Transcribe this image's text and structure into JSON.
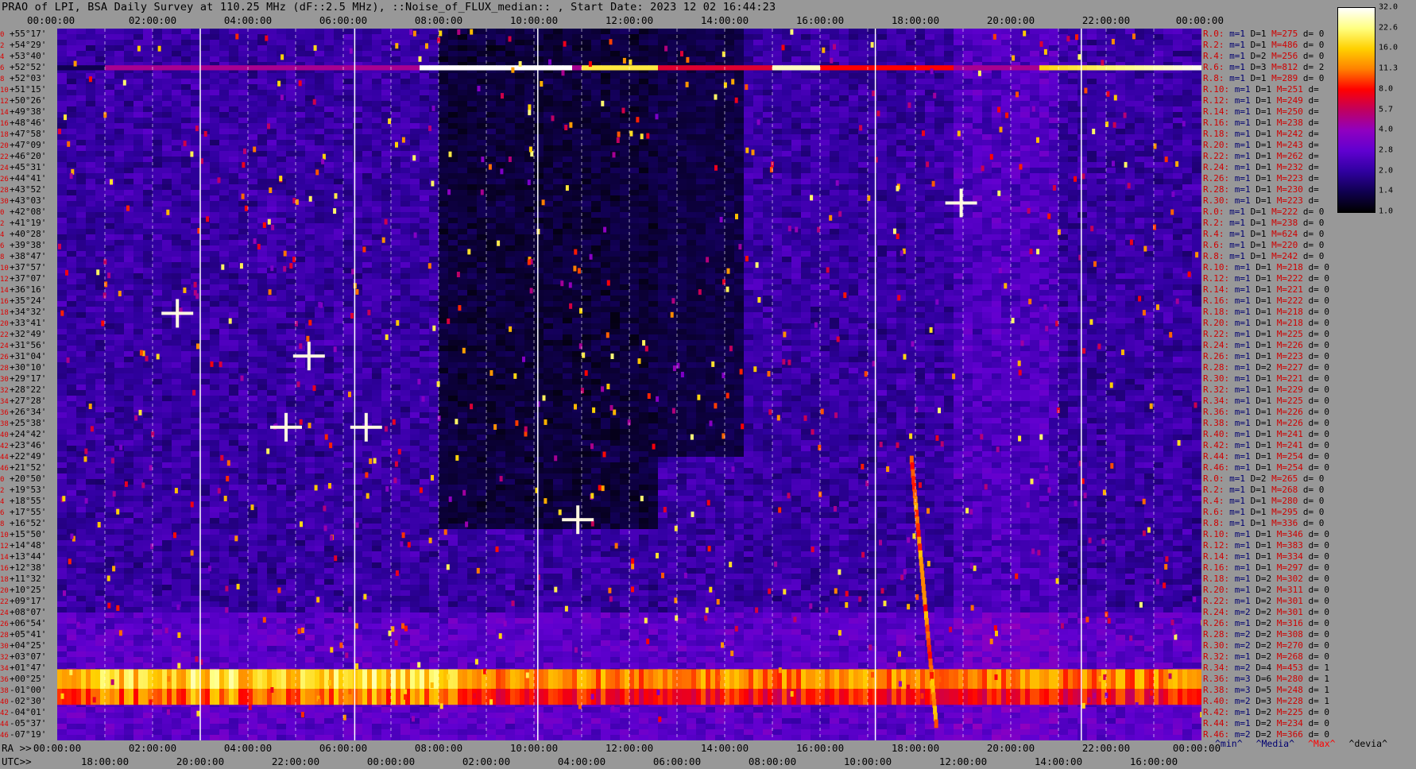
{
  "title": "PRAO of LPI, BSA Daily Survey at 110.25 MHz (dF::2.5 MHz), ::Noise_of_FLUX_median:: , Start Date: 2023 12 02 16:44:23",
  "top_axis_labels": [
    "00:00:00",
    "02:00:00",
    "04:00:00",
    "06:00:00",
    "08:00:00",
    "10:00:00",
    "12:00:00",
    "14:00:00",
    "16:00:00",
    "18:00:00",
    "20:00:00",
    "22:00:00",
    "00:00:00"
  ],
  "bottom_axis": {
    "ra_prefix": "RA >>",
    "ra_labels": [
      "00:00:00",
      "02:00:00",
      "04:00:00",
      "06:00:00",
      "08:00:00",
      "10:00:00",
      "12:00:00",
      "14:00:00",
      "16:00:00",
      "18:00:00",
      "20:00:00",
      "22:00:00",
      "00:00:00"
    ],
    "utc_prefix": "UTC>>",
    "utc_labels": [
      "18:00:00",
      "20:00:00",
      "22:00:00",
      "00:00:00",
      "02:00:00",
      "04:00:00",
      "06:00:00",
      "08:00:00",
      "10:00:00",
      "12:00:00",
      "14:00:00",
      "16:00:00"
    ]
  },
  "colorbar": {
    "ticks": [
      "32.0",
      "22.6",
      "16.0",
      "11.3",
      "8.0",
      "5.7",
      "4.0",
      "2.8",
      "2.0",
      "1.4",
      "1.0"
    ],
    "colors": [
      "#ffffff",
      "#ffff80",
      "#ffd000",
      "#ff8000",
      "#ff0000",
      "#c00060",
      "#9000c0",
      "#6000d0",
      "#3000a0",
      "#100050",
      "#000000"
    ]
  },
  "legend_keys": {
    "min": "^min^",
    "median": "^Media^",
    "max": "^Max^",
    "devia": "^devia^",
    "min_color": "#000070",
    "median_color": "#000070",
    "max_color": "#ff0000",
    "devia_color": "#000000"
  },
  "rows": [
    {
      "idx": "0",
      "dec": "+55°17'",
      "r": "R.0:",
      "m": "m=1",
      "D": "D=1",
      "M": "M=275",
      "d": "d= 0"
    },
    {
      "idx": "2",
      "dec": "+54°29'",
      "r": "R.2:",
      "m": "m=1",
      "D": "D=1",
      "M": "M=486",
      "d": "d= 0"
    },
    {
      "idx": "4",
      "dec": "+53°40'",
      "r": "R.4:",
      "m": "m=1",
      "D": "D=2",
      "M": "M=256",
      "d": "d= 0"
    },
    {
      "idx": "6",
      "dec": "+52°52'",
      "r": "R.6:",
      "m": "m=1",
      "D": "D=3",
      "M": "M=812",
      "d": "d= 2"
    },
    {
      "idx": "8",
      "dec": "+52°03'",
      "r": "R.8:",
      "m": "m=1",
      "D": "D=1",
      "M": "M=289",
      "d": "d= 0"
    },
    {
      "idx": "10",
      "dec": "+51°15'",
      "r": "R.10:",
      "m": "m=1",
      "D": "D=1",
      "M": "M=251",
      "d": "d="
    },
    {
      "idx": "12",
      "dec": "+50°26'",
      "r": "R.12:",
      "m": "m=1",
      "D": "D=1",
      "M": "M=249",
      "d": "d="
    },
    {
      "idx": "14",
      "dec": "+49°38'",
      "r": "R.14:",
      "m": "m=1",
      "D": "D=1",
      "M": "M=250",
      "d": "d="
    },
    {
      "idx": "16",
      "dec": "+48°46'",
      "r": "R.16:",
      "m": "m=1",
      "D": "D=1",
      "M": "M=238",
      "d": "d="
    },
    {
      "idx": "18",
      "dec": "+47°58'",
      "r": "R.18:",
      "m": "m=1",
      "D": "D=1",
      "M": "M=242",
      "d": "d="
    },
    {
      "idx": "20",
      "dec": "+47°09'",
      "r": "R.20:",
      "m": "m=1",
      "D": "D=1",
      "M": "M=243",
      "d": "d="
    },
    {
      "idx": "22",
      "dec": "+46°20'",
      "r": "R.22:",
      "m": "m=1",
      "D": "D=1",
      "M": "M=262",
      "d": "d="
    },
    {
      "idx": "24",
      "dec": "+45°31'",
      "r": "R.24:",
      "m": "m=1",
      "D": "D=1",
      "M": "M=232",
      "d": "d="
    },
    {
      "idx": "26",
      "dec": "+44°41'",
      "r": "R.26:",
      "m": "m=1",
      "D": "D=1",
      "M": "M=223",
      "d": "d="
    },
    {
      "idx": "28",
      "dec": "+43°52'",
      "r": "R.28:",
      "m": "m=1",
      "D": "D=1",
      "M": "M=230",
      "d": "d="
    },
    {
      "idx": "30",
      "dec": "+43°03'",
      "r": "R.30:",
      "m": "m=1",
      "D": "D=1",
      "M": "M=223",
      "d": "d="
    },
    {
      "idx": "0",
      "dec": "+42°08'",
      "r": "R.0:",
      "m": "m=1",
      "D": "D=1",
      "M": "M=222",
      "d": "d= 0"
    },
    {
      "idx": "2",
      "dec": "+41°19'",
      "r": "R.2:",
      "m": "m=1",
      "D": "D=1",
      "M": "M=238",
      "d": "d= 0"
    },
    {
      "idx": "4",
      "dec": "+40°28'",
      "r": "R.4:",
      "m": "m=1",
      "D": "D=1",
      "M": "M=624",
      "d": "d= 0"
    },
    {
      "idx": "6",
      "dec": "+39°38'",
      "r": "R.6:",
      "m": "m=1",
      "D": "D=1",
      "M": "M=220",
      "d": "d= 0"
    },
    {
      "idx": "8",
      "dec": "+38°47'",
      "r": "R.8:",
      "m": "m=1",
      "D": "D=1",
      "M": "M=242",
      "d": "d= 0"
    },
    {
      "idx": "10",
      "dec": "+37°57'",
      "r": "R.10:",
      "m": "m=1",
      "D": "D=1",
      "M": "M=218",
      "d": "d= 0"
    },
    {
      "idx": "12",
      "dec": "+37°07'",
      "r": "R.12:",
      "m": "m=1",
      "D": "D=1",
      "M": "M=222",
      "d": "d= 0"
    },
    {
      "idx": "14",
      "dec": "+36°16'",
      "r": "R.14:",
      "m": "m=1",
      "D": "D=1",
      "M": "M=221",
      "d": "d= 0"
    },
    {
      "idx": "16",
      "dec": "+35°24'",
      "r": "R.16:",
      "m": "m=1",
      "D": "D=1",
      "M": "M=222",
      "d": "d= 0"
    },
    {
      "idx": "18",
      "dec": "+34°32'",
      "r": "R.18:",
      "m": "m=1",
      "D": "D=1",
      "M": "M=218",
      "d": "d= 0"
    },
    {
      "idx": "20",
      "dec": "+33°41'",
      "r": "R.20:",
      "m": "m=1",
      "D": "D=1",
      "M": "M=218",
      "d": "d= 0"
    },
    {
      "idx": "22",
      "dec": "+32°49'",
      "r": "R.22:",
      "m": "m=1",
      "D": "D=1",
      "M": "M=225",
      "d": "d= 0"
    },
    {
      "idx": "24",
      "dec": "+31°56'",
      "r": "R.24:",
      "m": "m=1",
      "D": "D=1",
      "M": "M=226",
      "d": "d= 0"
    },
    {
      "idx": "26",
      "dec": "+31°04'",
      "r": "R.26:",
      "m": "m=1",
      "D": "D=1",
      "M": "M=223",
      "d": "d= 0"
    },
    {
      "idx": "28",
      "dec": "+30°10'",
      "r": "R.28:",
      "m": "m=1",
      "D": "D=2",
      "M": "M=227",
      "d": "d= 0"
    },
    {
      "idx": "30",
      "dec": "+29°17'",
      "r": "R.30:",
      "m": "m=1",
      "D": "D=1",
      "M": "M=221",
      "d": "d= 0"
    },
    {
      "idx": "32",
      "dec": "+28°22'",
      "r": "R.32:",
      "m": "m=1",
      "D": "D=1",
      "M": "M=229",
      "d": "d= 0"
    },
    {
      "idx": "34",
      "dec": "+27°28'",
      "r": "R.34:",
      "m": "m=1",
      "D": "D=1",
      "M": "M=225",
      "d": "d= 0"
    },
    {
      "idx": "36",
      "dec": "+26°34'",
      "r": "R.36:",
      "m": "m=1",
      "D": "D=1",
      "M": "M=226",
      "d": "d= 0"
    },
    {
      "idx": "38",
      "dec": "+25°38'",
      "r": "R.38:",
      "m": "m=1",
      "D": "D=1",
      "M": "M=226",
      "d": "d= 0"
    },
    {
      "idx": "40",
      "dec": "+24°42'",
      "r": "R.40:",
      "m": "m=1",
      "D": "D=1",
      "M": "M=241",
      "d": "d= 0"
    },
    {
      "idx": "42",
      "dec": "+23°46'",
      "r": "R.42:",
      "m": "m=1",
      "D": "D=1",
      "M": "M=241",
      "d": "d= 0"
    },
    {
      "idx": "44",
      "dec": "+22°49'",
      "r": "R.44:",
      "m": "m=1",
      "D": "D=1",
      "M": "M=254",
      "d": "d= 0"
    },
    {
      "idx": "46",
      "dec": "+21°52'",
      "r": "R.46:",
      "m": "m=1",
      "D": "D=1",
      "M": "M=254",
      "d": "d= 0"
    },
    {
      "idx": "0",
      "dec": "+20°50'",
      "r": "R.0:",
      "m": "m=1",
      "D": "D=2",
      "M": "M=265",
      "d": "d= 0"
    },
    {
      "idx": "2",
      "dec": "+19°53'",
      "r": "R.2:",
      "m": "m=1",
      "D": "D=1",
      "M": "M=268",
      "d": "d= 0"
    },
    {
      "idx": "4",
      "dec": "+18°55'",
      "r": "R.4:",
      "m": "m=1",
      "D": "D=1",
      "M": "M=280",
      "d": "d= 0"
    },
    {
      "idx": "6",
      "dec": "+17°55'",
      "r": "R.6:",
      "m": "m=1",
      "D": "D=1",
      "M": "M=295",
      "d": "d= 0"
    },
    {
      "idx": "8",
      "dec": "+16°52'",
      "r": "R.8:",
      "m": "m=1",
      "D": "D=1",
      "M": "M=336",
      "d": "d= 0"
    },
    {
      "idx": "10",
      "dec": "+15°50'",
      "r": "R.10:",
      "m": "m=1",
      "D": "D=1",
      "M": "M=346",
      "d": "d= 0"
    },
    {
      "idx": "12",
      "dec": "+14°48'",
      "r": "R.12:",
      "m": "m=1",
      "D": "D=1",
      "M": "M=383",
      "d": "d= 0"
    },
    {
      "idx": "14",
      "dec": "+13°44'",
      "r": "R.14:",
      "m": "m=1",
      "D": "D=1",
      "M": "M=334",
      "d": "d= 0"
    },
    {
      "idx": "16",
      "dec": "+12°38'",
      "r": "R.16:",
      "m": "m=1",
      "D": "D=1",
      "M": "M=297",
      "d": "d= 0"
    },
    {
      "idx": "18",
      "dec": "+11°32'",
      "r": "R.18:",
      "m": "m=1",
      "D": "D=2",
      "M": "M=302",
      "d": "d= 0"
    },
    {
      "idx": "20",
      "dec": "+10°25'",
      "r": "R.20:",
      "m": "m=1",
      "D": "D=2",
      "M": "M=311",
      "d": "d= 0"
    },
    {
      "idx": "22",
      "dec": "+09°17'",
      "r": "R.22:",
      "m": "m=1",
      "D": "D=2",
      "M": "M=301",
      "d": "d= 0"
    },
    {
      "idx": "24",
      "dec": "+08°07'",
      "r": "R.24:",
      "m": "m=2",
      "D": "D=2",
      "M": "M=301",
      "d": "d= 0"
    },
    {
      "idx": "26",
      "dec": "+06°54'",
      "r": "R.26:",
      "m": "m=1",
      "D": "D=2",
      "M": "M=316",
      "d": "d= 0"
    },
    {
      "idx": "28",
      "dec": "+05°41'",
      "r": "R.28:",
      "m": "m=2",
      "D": "D=2",
      "M": "M=308",
      "d": "d= 0"
    },
    {
      "idx": "30",
      "dec": "+04°25'",
      "r": "R.30:",
      "m": "m=2",
      "D": "D=2",
      "M": "M=270",
      "d": "d= 0"
    },
    {
      "idx": "32",
      "dec": "+03°07'",
      "r": "R.32:",
      "m": "m=1",
      "D": "D=2",
      "M": "M=268",
      "d": "d= 0"
    },
    {
      "idx": "34",
      "dec": "+01°47'",
      "r": "R.34:",
      "m": "m=2",
      "D": "D=4",
      "M": "M=453",
      "d": "d= 1"
    },
    {
      "idx": "36",
      "dec": "+00°25'",
      "r": "R.36:",
      "m": "m=3",
      "D": "D=6",
      "M": "M=280",
      "d": "d= 1"
    },
    {
      "idx": "38",
      "dec": "-01°00'",
      "r": "R.38:",
      "m": "m=3",
      "D": "D=5",
      "M": "M=248",
      "d": "d= 1"
    },
    {
      "idx": "40",
      "dec": "-02°30'",
      "r": "R.40:",
      "m": "m=2",
      "D": "D=3",
      "M": "M=228",
      "d": "d= 1"
    },
    {
      "idx": "42",
      "dec": "-04°01'",
      "r": "R.42:",
      "m": "m=1",
      "D": "D=2",
      "M": "M=225",
      "d": "d= 0"
    },
    {
      "idx": "44",
      "dec": "-05°37'",
      "r": "R.44:",
      "m": "m=1",
      "D": "D=2",
      "M": "M=234",
      "d": "d= 0"
    },
    {
      "idx": "46",
      "dec": "-07°19'",
      "r": "R.46:",
      "m": "m=2",
      "D": "D=2",
      "M": "M=366",
      "d": "d= 0"
    }
  ],
  "chart_data": {
    "type": "heatmap",
    "title": "PRAO of LPI, BSA Daily Survey at 110.25 MHz (dF::2.5 MHz), ::Noise_of_FLUX_median:: , Start Date: 2023 12 02 16:44:23",
    "xlabel": "RA / UTC",
    "x_range": [
      "00:00:00",
      "00:00:00"
    ],
    "y_range": [
      "+55°17'",
      "-07°19'"
    ],
    "color_scale": {
      "min": 1.0,
      "max": 32.0,
      "scale": "log2"
    },
    "ray_count": 64,
    "grid": true
  }
}
